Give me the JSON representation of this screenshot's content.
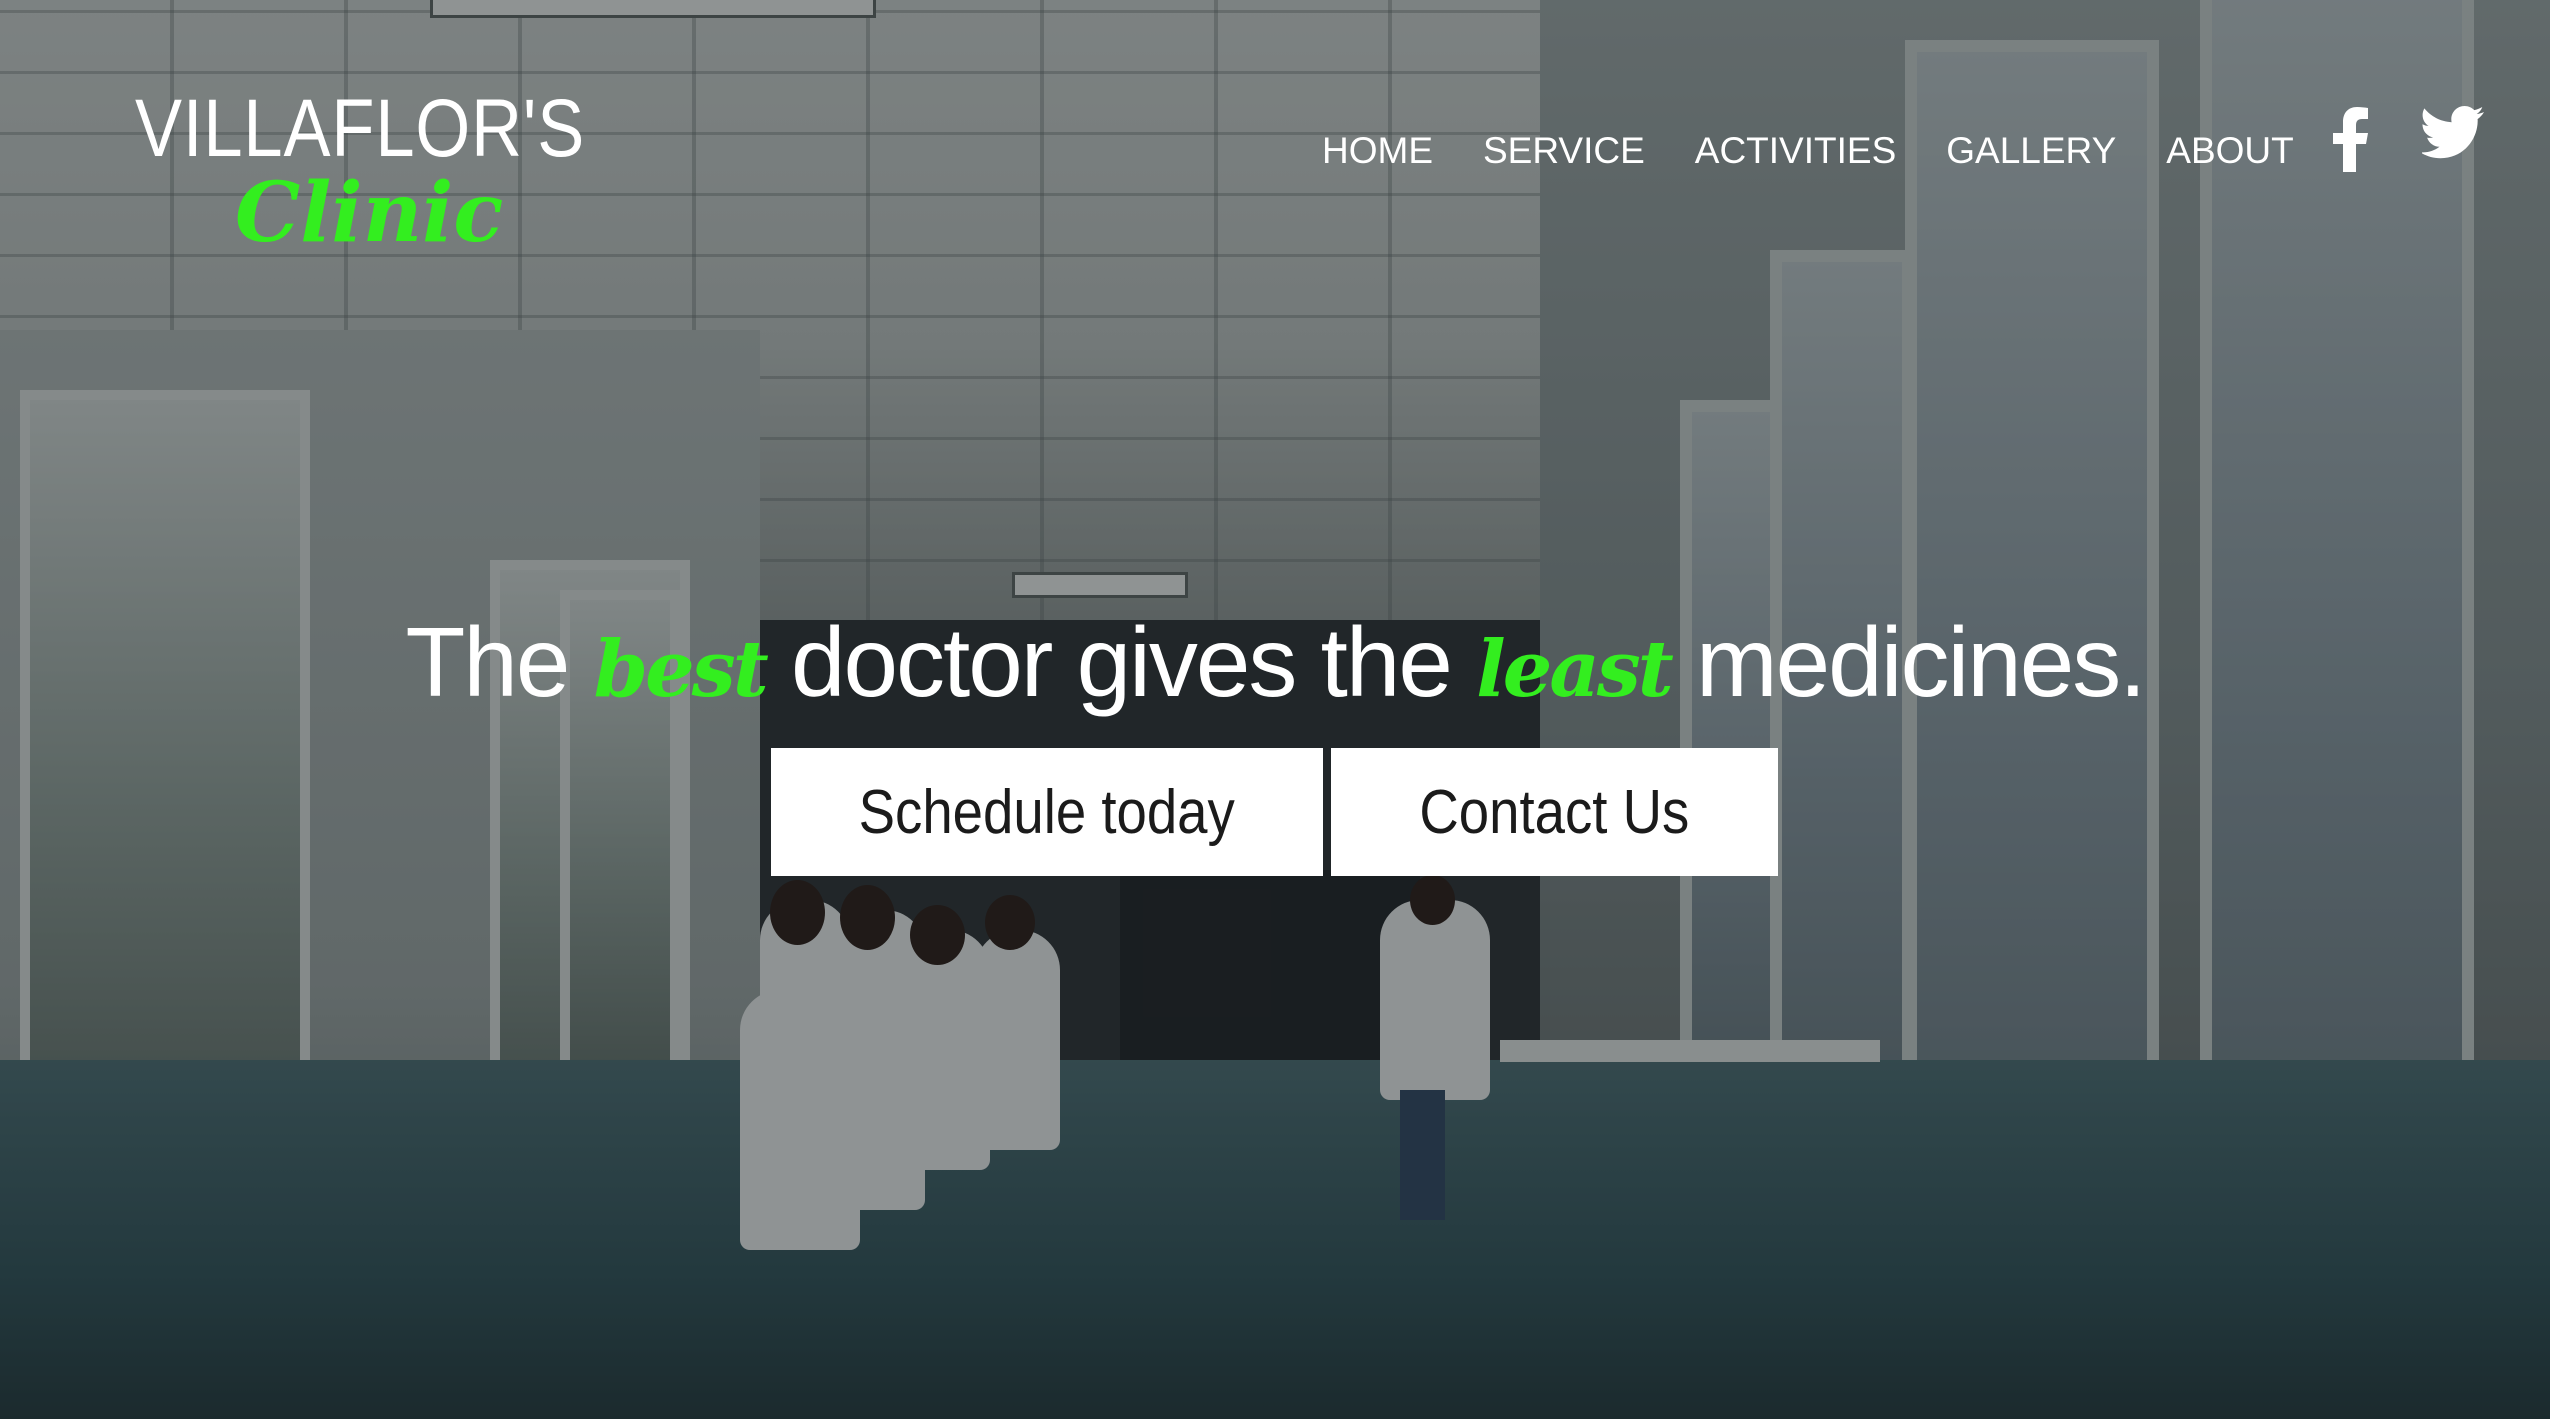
{
  "brand": {
    "name": "VILLAFLOR'S",
    "subtitle": "Clinic"
  },
  "nav": {
    "items": [
      {
        "label": "HOME"
      },
      {
        "label": "SERVICE"
      },
      {
        "label": "ACTIVITIES"
      },
      {
        "label": "GALLERY"
      },
      {
        "label": "ABOUT"
      }
    ]
  },
  "social": {
    "icons": [
      "facebook-icon",
      "twitter-icon"
    ]
  },
  "hero": {
    "headline": {
      "part1": "The",
      "accent1": "best",
      "part2": "doctor gives the",
      "accent2": "least",
      "part3": "medicines."
    },
    "buttons": {
      "schedule": "Schedule today",
      "contact": "Contact Us"
    }
  },
  "colors": {
    "accent": "#33ee1f",
    "text": "#ffffff",
    "button_bg": "#ffffff"
  }
}
